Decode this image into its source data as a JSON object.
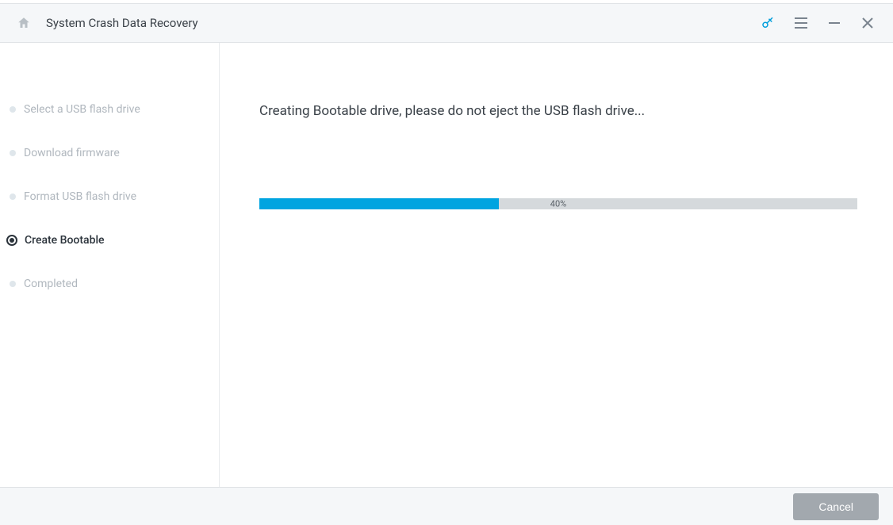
{
  "header": {
    "title": "System Crash Data Recovery"
  },
  "sidebar": {
    "steps": [
      {
        "label": "Select a USB flash drive",
        "active": false
      },
      {
        "label": "Download firmware",
        "active": false
      },
      {
        "label": "Format USB flash drive",
        "active": false
      },
      {
        "label": "Create Bootable",
        "active": true
      },
      {
        "label": "Completed",
        "active": false
      }
    ]
  },
  "main": {
    "status": "Creating Bootable drive, please do not eject the USB flash drive...",
    "progress_percent": 40,
    "progress_label": "40%"
  },
  "footer": {
    "cancel_label": "Cancel"
  },
  "colors": {
    "accent": "#009edb",
    "progress_fill": "#00a4e0",
    "progress_track": "#d5d9dc",
    "header_bg": "#f5f7f9"
  }
}
